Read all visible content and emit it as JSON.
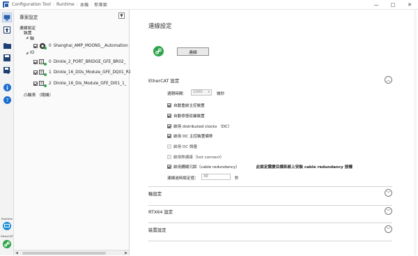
{
  "window": {
    "app_name": "Configuration Tool",
    "runtime": "Runtime",
    "host": "本機",
    "project": "新專案",
    "controls": {
      "minimize": "—",
      "maximize": "□",
      "close": "✕"
    }
  },
  "rail": {
    "runtime_label": "Runtime",
    "ethercat_label": "EtherCAT"
  },
  "project_panel": {
    "title": "專案設定",
    "tree": {
      "connection": "連線設定",
      "device": "裝置",
      "axis": "軸",
      "io": "IO",
      "axis_devices": [
        {
          "index": "0",
          "name": "Shanghai_AMP_MOONS__Automation"
        }
      ],
      "io_devices": [
        {
          "index": "0",
          "name": "Dinkle_2_PORT_BRIDGE_GFE_BR02_"
        },
        {
          "index": "1",
          "name": "Dinkle_16_DOs_Module_GFE_DQ01_R1"
        },
        {
          "index": "2",
          "name": "Dinkle_16_DIs_Module_GFE_DI01_1_"
        }
      ],
      "cam_table": "凸輪表 （隨機）"
    }
  },
  "main": {
    "title": "連線設定",
    "connect_button": "連線",
    "ethercat": {
      "title": "EtherCAT 設定",
      "cycle_label": "週期時間：",
      "cycle_value": "1000",
      "cycle_unit": "微秒",
      "options": [
        {
          "label": "自動重啟主控裝置",
          "checked": true
        },
        {
          "label": "自動修復從屬裝置",
          "checked": true
        },
        {
          "label": "啟用 distributed clocks （DC）",
          "checked": true
        },
        {
          "label": "啟用 DC 主控裝置偏移",
          "checked": true
        },
        {
          "label": "啟用 DC 微量",
          "checked": false
        },
        {
          "label": "啟用熱連接（hot connect）",
          "checked": false
        },
        {
          "label": "啟用纜線冗餘（cable redundancy）",
          "checked": true,
          "note": "此設定需要目標系統上安裝 cable redundancy 授權"
        }
      ],
      "timeout_label": "連線逾時設定值：",
      "timeout_value": "30",
      "timeout_unit": "秒"
    },
    "sections": [
      "軸設定",
      "RTX64 設定",
      "裝置設定"
    ]
  }
}
